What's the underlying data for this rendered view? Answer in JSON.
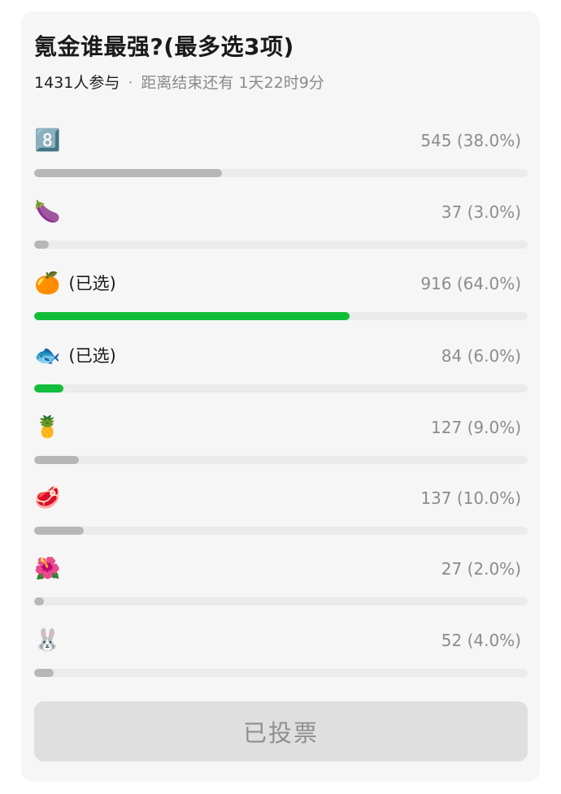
{
  "poll": {
    "title": "氪金谁最强?(最多选3项)",
    "participants": "1431人参与",
    "separator": "·",
    "deadline": "距离结束还有 1天22时9分",
    "options": [
      {
        "emoji": "8️⃣",
        "icon_name": "keycap-eight-icon",
        "selected": false,
        "selected_label": "",
        "count_text": "545 (38.0%)",
        "percent": 38.0
      },
      {
        "emoji": "🍆",
        "icon_name": "eggplant-icon",
        "selected": false,
        "selected_label": "",
        "count_text": "37 (3.0%)",
        "percent": 3.0
      },
      {
        "emoji": "🍊",
        "icon_name": "tangerine-icon",
        "selected": true,
        "selected_label": "(已选)",
        "count_text": "916 (64.0%)",
        "percent": 64.0
      },
      {
        "emoji": "🐟",
        "icon_name": "fish-icon",
        "selected": true,
        "selected_label": "(已选)",
        "count_text": "84 (6.0%)",
        "percent": 6.0
      },
      {
        "emoji": "🍍",
        "icon_name": "pineapple-icon",
        "selected": false,
        "selected_label": "",
        "count_text": "127 (9.0%)",
        "percent": 9.0
      },
      {
        "emoji": "🥩",
        "icon_name": "cut-of-meat-icon",
        "selected": false,
        "selected_label": "",
        "count_text": "137 (10.0%)",
        "percent": 10.0
      },
      {
        "emoji": "🌺",
        "icon_name": "hibiscus-icon",
        "selected": false,
        "selected_label": "",
        "count_text": "27 (2.0%)",
        "percent": 2.0
      },
      {
        "emoji": "🐰",
        "icon_name": "rabbit-face-icon",
        "selected": false,
        "selected_label": "",
        "count_text": "52 (4.0%)",
        "percent": 4.0
      }
    ],
    "vote_button_label": "已投票",
    "colors": {
      "selected_bar": "#12bd3a",
      "unselected_bar": "#b7b7b7",
      "track": "#ebebeb"
    }
  }
}
